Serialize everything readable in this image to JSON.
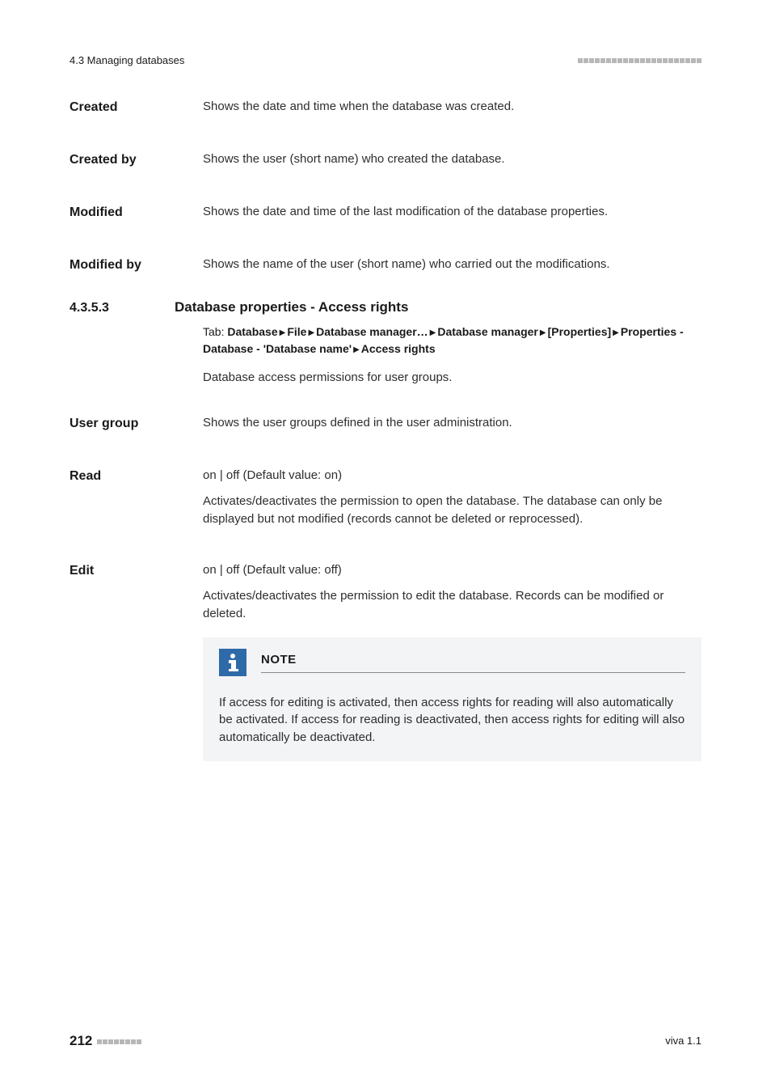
{
  "header": {
    "section": "4.3 Managing databases"
  },
  "entries": [
    {
      "term": "Created",
      "desc": "Shows the date and time when the database was created."
    },
    {
      "term": "Created by",
      "desc": "Shows the user (short name) who created the database."
    },
    {
      "term": "Modified",
      "desc": "Shows the date and time of the last modification of the database properties."
    },
    {
      "term": "Modified by",
      "desc": "Shows the name of the user (short name) who carried out the modifications."
    }
  ],
  "section": {
    "number": "4.3.5.3",
    "title": "Database properties - Access rights",
    "tab_prefix": "Tab: ",
    "tab_parts": [
      "Database",
      "File",
      "Database manager…",
      "Database manager",
      "[Properties]",
      "Properties - Database - 'Database name'",
      "Access rights"
    ],
    "intro": "Database access permissions for user groups."
  },
  "ug": {
    "term": "User group",
    "desc": "Shows the user groups defined in the user administration."
  },
  "read": {
    "term": "Read",
    "opt_on": "on",
    "opt_sep": " | ",
    "opt_off": "off",
    "default_label": " (Default value: ",
    "default_val": "on",
    "default_close": ")",
    "desc": "Activates/deactivates the permission to open the database. The database can only be displayed but not modified (records cannot be deleted or reprocessed)."
  },
  "edit": {
    "term": "Edit",
    "opt_on": "on",
    "opt_sep": " | ",
    "opt_off": "off",
    "default_label": " (Default value: ",
    "default_val": "off",
    "default_close": ")",
    "desc": "Activates/deactivates the permission to edit the database. Records can be modified or deleted."
  },
  "note": {
    "title": "NOTE",
    "body": "If access for editing is activated, then access rights for reading will also automatically be activated. If access for reading is deactivated, then access rights for editing will also automatically be deactivated."
  },
  "footer": {
    "page": "212",
    "version": "viva 1.1"
  }
}
